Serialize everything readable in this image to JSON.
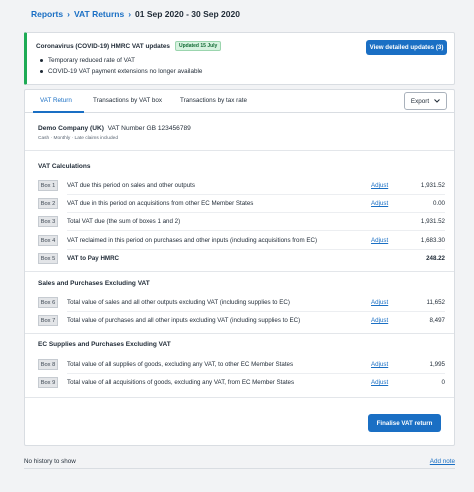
{
  "breadcrumb": {
    "items": [
      "Reports",
      "VAT Returns"
    ],
    "separator": "›",
    "current": "01 Sep 2020 - 30 Sep 2020"
  },
  "notice": {
    "title": "Coronavirus (COVID-19) HMRC VAT updates",
    "badge": "Updated 15 July",
    "bullets": [
      "Temporary reduced rate of VAT",
      "COVID-19 VAT payment extensions no longer available"
    ],
    "button_label": "View detailed updates (3)"
  },
  "tabs": [
    {
      "label": "VAT Return",
      "active": true
    },
    {
      "label": "Transactions by VAT box",
      "active": false
    },
    {
      "label": "Transactions by tax rate",
      "active": false
    }
  ],
  "export": {
    "label": "Export",
    "icon": "chevron-down-icon"
  },
  "company": {
    "name": "Demo Company (UK)",
    "vat_number": "VAT Number GB 123456789",
    "subline": "Cash  ·  Monthly  ·  Late claims included"
  },
  "sections": [
    {
      "title": "VAT Calculations",
      "rows": [
        {
          "box": "Box 1",
          "desc": "VAT due this period on sales and other outputs",
          "adjust": "Adjust",
          "value": "1,931.52",
          "bold": false
        },
        {
          "box": "Box 2",
          "desc": "VAT due in this period on acquisitions from other EC Member States",
          "adjust": "Adjust",
          "value": "0.00",
          "bold": false
        },
        {
          "box": "Box 3",
          "desc": "Total VAT due (the sum of boxes 1 and 2)",
          "adjust": "",
          "value": "1,931.52",
          "bold": false
        },
        {
          "box": "Box 4",
          "desc": "VAT reclaimed in this period on purchases and other inputs (including acquisitions from EC)",
          "adjust": "Adjust",
          "value": "1,683.30",
          "bold": false
        },
        {
          "box": "Box 5",
          "desc": "VAT to Pay HMRC",
          "adjust": "",
          "value": "248.22",
          "bold": true
        }
      ]
    },
    {
      "title": "Sales and Purchases Excluding VAT",
      "rows": [
        {
          "box": "Box 6",
          "desc": "Total value of sales and all other outputs excluding VAT (including supplies to EC)",
          "adjust": "Adjust",
          "value": "11,652",
          "bold": false
        },
        {
          "box": "Box 7",
          "desc": "Total value of purchases and all other inputs excluding VAT (including supplies to EC)",
          "adjust": "Adjust",
          "value": "8,497",
          "bold": false
        }
      ]
    },
    {
      "title": "EC Supplies and Purchases Excluding VAT",
      "rows": [
        {
          "box": "Box 8",
          "desc": "Total value of all supplies of goods, excluding any VAT, to other EC Member States",
          "adjust": "Adjust",
          "value": "1,995",
          "bold": false
        },
        {
          "box": "Box 9",
          "desc": "Total value of all acquisitions of goods, excluding any VAT, from EC Member States",
          "adjust": "Adjust",
          "value": "0",
          "bold": false
        }
      ]
    }
  ],
  "finalise_label": "Finalise VAT return",
  "footer": {
    "history_text": "No history to show",
    "add_note_label": "Add note"
  },
  "colors": {
    "accent": "#1a6fc4",
    "success": "#1eab55",
    "background": "#f2f3f5"
  }
}
